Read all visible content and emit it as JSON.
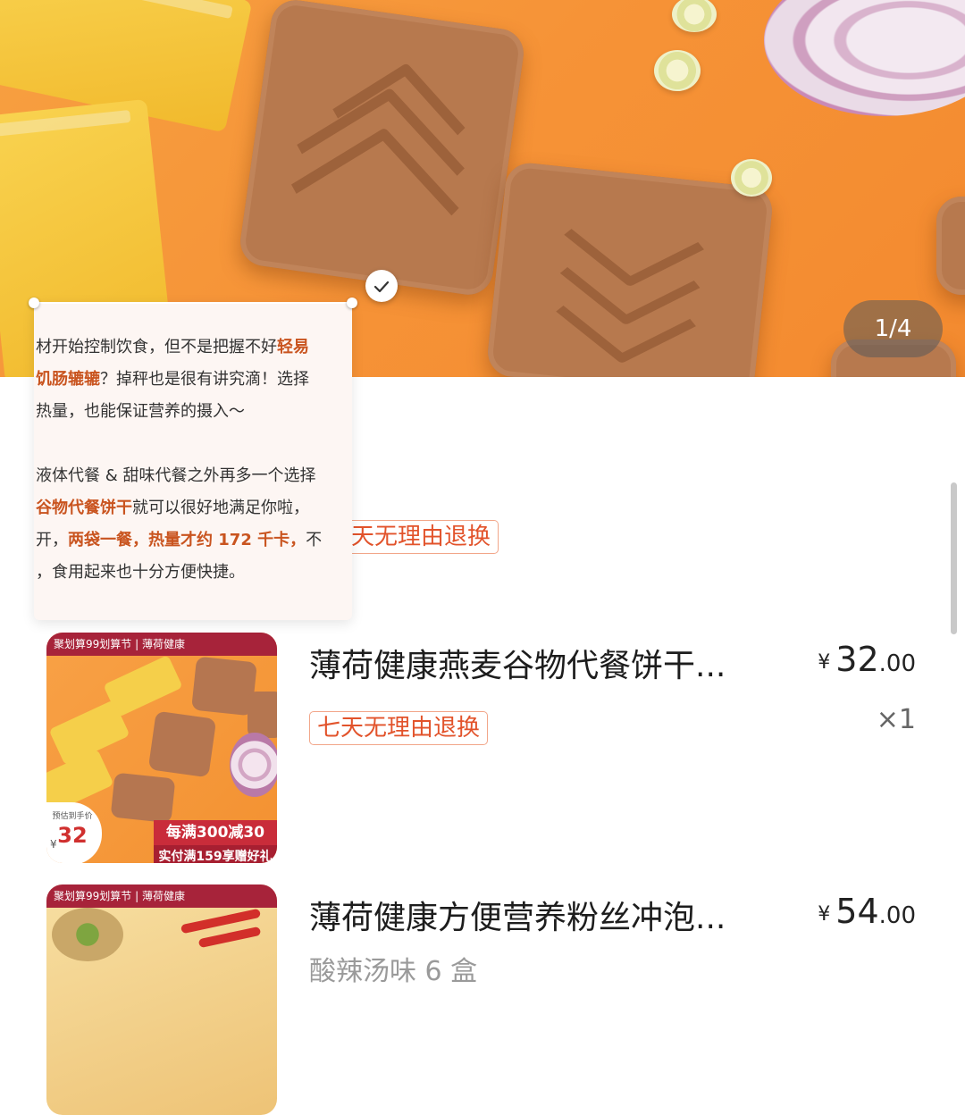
{
  "banner": {
    "image_counter": "1/4"
  },
  "popup": {
    "lines": [
      {
        "pre": "材开始控制饮食，但不是把握不好",
        "hl": "轻易",
        "post": ""
      },
      {
        "pre": "",
        "hl": "饥肠辘辘",
        "post": "？掉秤也是很有讲究滴！选择"
      },
      {
        "pre": "热量，也能保证营养的摄入～",
        "hl": "",
        "post": ""
      },
      {
        "pre": "液体代餐 & 甜味代餐之外再多一个选择",
        "hl": "",
        "post": ""
      },
      {
        "pre": "",
        "hl": "谷物代餐饼干",
        "post": "就可以很好地满足你啦，"
      },
      {
        "pre": "开，",
        "hl": "两袋一餐，热量才约 172 千卡，",
        "post": "不"
      },
      {
        "pre": "，食用起来也十分方便快捷。",
        "hl": "",
        "post": ""
      }
    ]
  },
  "products": [
    {
      "title": "薄荷健康燕麦谷物代餐饼干...",
      "price_int": "32",
      "price_dec": ".00",
      "currency": "¥",
      "quantity": "×1",
      "tag": "七天无理由退换",
      "thumb": {
        "header": "聚划算99划算节 | 薄荷健康",
        "promo1": "每满300减30",
        "promo2": "实付满159享赠好礼",
        "badge_label": "预估到手价",
        "badge_currency": "¥",
        "badge_value": "32"
      }
    },
    {
      "title": "薄荷健康方便营养粉丝冲泡...",
      "price_int": "54",
      "price_dec": ".00",
      "currency": "¥",
      "subtitle": "酸辣汤味 6 盒",
      "thumb": {
        "header": "聚划算99划算节 | 薄荷健康"
      }
    }
  ],
  "partial_tag": "天无理由退换",
  "icons": {
    "check": "check-icon"
  },
  "colors": {
    "banner_orange": "#f69337",
    "tag_red": "#e2532b",
    "promo_red": "#c92c3a"
  }
}
